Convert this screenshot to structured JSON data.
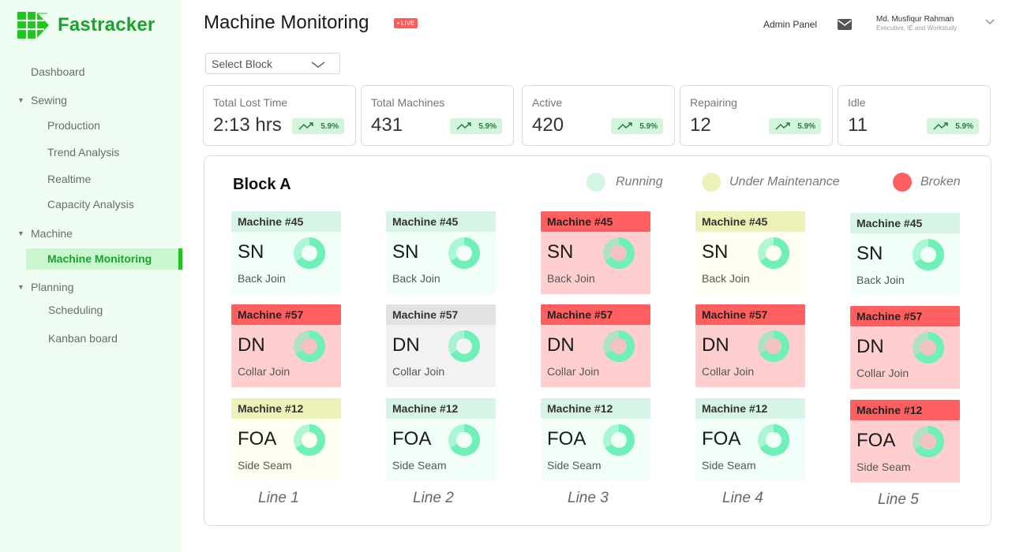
{
  "app": {
    "name": "Fastracker"
  },
  "sidebar": {
    "dashboard": "Dashboard",
    "groups": [
      {
        "label": "Sewing",
        "items": [
          "Production",
          "Trend Analysis",
          "Realtime",
          "Capacity Analysis"
        ]
      },
      {
        "label": "Machine",
        "items": [
          "Machine Monitoring"
        ]
      },
      {
        "label": "Planning",
        "items": [
          "Scheduling",
          "Kanban board"
        ]
      }
    ],
    "active_item": "Machine Monitoring"
  },
  "header": {
    "title": "Machine Monitoring",
    "live_badge": "• LIVE",
    "admin_panel": "Admin Panel",
    "user_name": "Md. Musfiqur Rahman",
    "user_role": "Executive, IE and Workstudy"
  },
  "filter": {
    "selected": "Select Block"
  },
  "stats": [
    {
      "label": "Total Lost Time",
      "value": "2:13 hrs",
      "change": "5.9%"
    },
    {
      "label": "Total Machines",
      "value": "431",
      "change": "5.9%"
    },
    {
      "label": "Active",
      "value": "420",
      "change": "5.9%"
    },
    {
      "label": "Repairing",
      "value": "12",
      "change": "5.9%"
    },
    {
      "label": "Idle",
      "value": "11",
      "change": "5.9%"
    }
  ],
  "block": {
    "title": "Block A",
    "legend": [
      {
        "label": "Running",
        "color": "#d2f5e4"
      },
      {
        "label": "Under Maintenance",
        "color": "#eef2b8"
      },
      {
        "label": "Broken",
        "color": "#ff5f5f"
      }
    ],
    "lines": [
      {
        "label": "Line 1",
        "machines": [
          {
            "name": "Machine #45",
            "code": "SN",
            "operation": "Back Join",
            "status": "running"
          },
          {
            "name": "Machine #57",
            "code": "DN",
            "operation": "Collar Join",
            "status": "broken"
          },
          {
            "name": "Machine #12",
            "code": "FOA",
            "operation": "Side Seam",
            "status": "maintenance"
          }
        ]
      },
      {
        "label": "Line 2",
        "machines": [
          {
            "name": "Machine #45",
            "code": "SN",
            "operation": "Back Join",
            "status": "running"
          },
          {
            "name": "Machine #57",
            "code": "DN",
            "operation": "Collar Join",
            "status": "idle"
          },
          {
            "name": "Machine #12",
            "code": "FOA",
            "operation": "Side Seam",
            "status": "running"
          }
        ]
      },
      {
        "label": "Line 3",
        "machines": [
          {
            "name": "Machine #45",
            "code": "SN",
            "operation": "Back Join",
            "status": "broken"
          },
          {
            "name": "Machine #57",
            "code": "DN",
            "operation": "Collar Join",
            "status": "broken"
          },
          {
            "name": "Machine #12",
            "code": "FOA",
            "operation": "Side Seam",
            "status": "running"
          }
        ]
      },
      {
        "label": "Line 4",
        "machines": [
          {
            "name": "Machine #45",
            "code": "SN",
            "operation": "Back Join",
            "status": "maintenance"
          },
          {
            "name": "Machine #57",
            "code": "DN",
            "operation": "Collar Join",
            "status": "broken"
          },
          {
            "name": "Machine #12",
            "code": "FOA",
            "operation": "Side Seam",
            "status": "running"
          }
        ]
      },
      {
        "label": "Line 5",
        "machines": [
          {
            "name": "Machine #45",
            "code": "SN",
            "operation": "Back Join",
            "status": "running"
          },
          {
            "name": "Machine #57",
            "code": "DN",
            "operation": "Collar Join",
            "status": "broken"
          },
          {
            "name": "Machine #12",
            "code": "FOA",
            "operation": "Side Seam",
            "status": "broken"
          }
        ]
      }
    ]
  },
  "colors": {
    "brand": "#1aa32a",
    "running_head": "#d6f5e6",
    "running_body": "#f2fff9",
    "maintenance_head": "#eef2b8",
    "maintenance_body": "#fffff2",
    "broken_head": "#ff5f5f",
    "broken_body": "#ffcfcf",
    "idle_head": "#e2e2e2",
    "idle_body": "#f2f2f2",
    "donut_green": "#6ef0b8",
    "donut_pink": "#f5c2c2"
  },
  "icons": {
    "logo": "grid-logo-icon",
    "mail": "mail-icon",
    "chevron": "chevron-down-icon",
    "trend": "trending-up-icon"
  }
}
